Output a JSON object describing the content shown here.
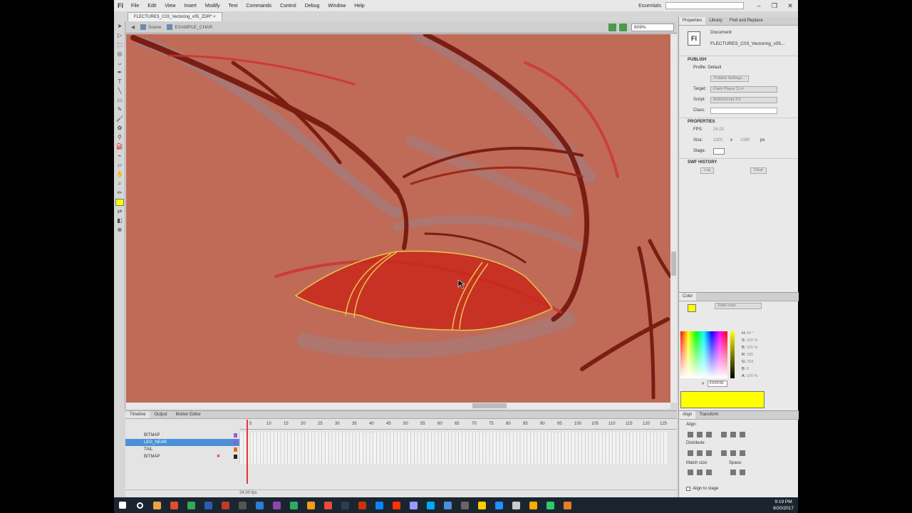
{
  "menu": [
    "File",
    "Edit",
    "View",
    "Insert",
    "Modify",
    "Text",
    "Commands",
    "Control",
    "Debug",
    "Window",
    "Help"
  ],
  "app_logo": "Fl",
  "workspace": "Essentials",
  "document_tab": "FLECTURES_C03_Vectoring_v05_ZDR*",
  "breadcrumb": {
    "scene": "Scene",
    "symbol": "EXAMPLE_CHAR"
  },
  "zoom": "609%",
  "timeline": {
    "tabs": [
      "Timeline",
      "Output",
      "Motion Editor"
    ],
    "frame_numbers": [
      "5",
      "10",
      "15",
      "20",
      "25",
      "30",
      "35",
      "40",
      "45",
      "50",
      "55",
      "60",
      "65",
      "70",
      "75",
      "80",
      "85",
      "90",
      "95",
      "100",
      "105",
      "110",
      "115",
      "120",
      "125"
    ],
    "layers": [
      "BITMAP",
      "LEG_NEAR",
      "TAIL",
      "BITMAP"
    ],
    "layer_colors": [
      "#9b59d0",
      "#9b59d0",
      "#e07020",
      "#222222"
    ],
    "status": "24.00 fps"
  },
  "properties": {
    "tabs": [
      "Properties",
      "Library",
      "Find and Replace"
    ],
    "doc_icon": "Fl",
    "doc_type": "Document",
    "doc_name": "FLECTURES_C03_Vectoring_v05...",
    "publish_header": "PUBLISH",
    "profile": "Profile: Default",
    "publish_settings": "Publish Settings...",
    "target_label": "Target:",
    "target": "Flash Player 11.4",
    "script_label": "Script:",
    "script": "ActionScript 3.0",
    "class_label": "Class:",
    "props_header": "PROPERTIES",
    "fps_label": "FPS:",
    "fps": "24.00",
    "size_label": "Size:",
    "size_w": "1920",
    "size_x": "x",
    "size_h": "1080",
    "size_unit": "px",
    "stage_label": "Stage:",
    "swf_header": "SWF HISTORY",
    "log_btn": "Log",
    "clear_btn": "Clear"
  },
  "color_panel": {
    "tabs": [
      "Color"
    ],
    "type": "Solid color",
    "h_label": "H:",
    "h": "60 °",
    "s_label": "S:",
    "s": "100 %",
    "b_label": "B:",
    "b": "100 %",
    "r_label": "R:",
    "r": "255",
    "g_label": "G:",
    "g": "255",
    "blue_label": "B:",
    "blue": "0",
    "a_label": "A:",
    "a": "100 %",
    "hex": "FFFF00",
    "fill_color": "#ffff00"
  },
  "align_panel": {
    "tabs": [
      "Align",
      "Transform"
    ],
    "align": "Align:",
    "distribute": "Distribute:",
    "match_size": "Match size:",
    "space": "Space:",
    "align_to_stage": "Align to stage"
  },
  "clock": {
    "time": "9:19 PM",
    "date": "8/20/2017"
  },
  "taskbar_icons": [
    "#e8a24a",
    "#e24c2c",
    "#34a853",
    "#2b5cab",
    "#c0392b",
    "#555555",
    "#2d7dd2",
    "#8e44ad",
    "#27ae60",
    "#f39c12",
    "#e74c3c",
    "#2c3e50",
    "#cc3300",
    "#0a84ff",
    "#ff3300",
    "#9999ff",
    "#00aaff",
    "#4a90d9",
    "#666666",
    "#ffcc00",
    "#1e90ff",
    "#cccccc",
    "#ffaa00",
    "#2ecc71",
    "#e67e22"
  ]
}
